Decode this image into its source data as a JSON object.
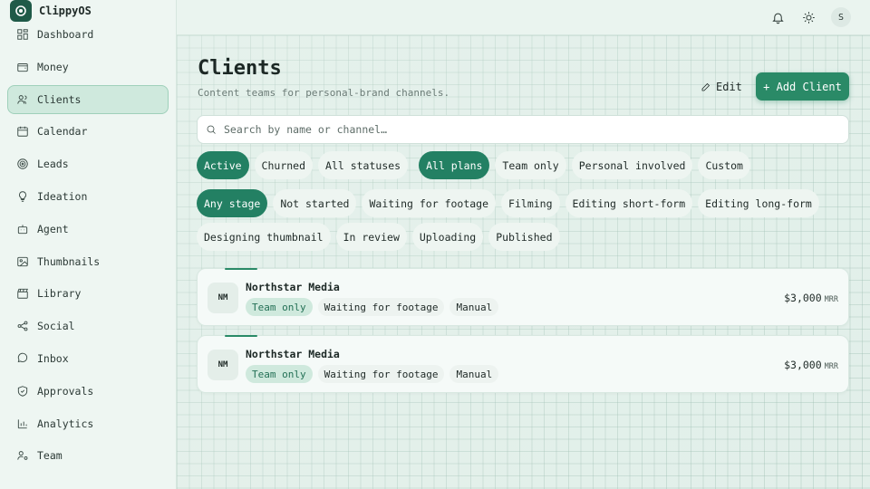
{
  "app": {
    "name": "ClippyOS"
  },
  "sidebar": {
    "items": [
      {
        "label": "Dashboard",
        "icon": "dashboard-icon"
      },
      {
        "label": "Money",
        "icon": "wallet-icon"
      },
      {
        "label": "Clients",
        "icon": "users-icon",
        "active": true
      },
      {
        "label": "Calendar",
        "icon": "calendar-icon"
      },
      {
        "label": "Leads",
        "icon": "target-icon"
      },
      {
        "label": "Ideation",
        "icon": "lightbulb-icon"
      },
      {
        "label": "Agent",
        "icon": "bot-icon"
      },
      {
        "label": "Thumbnails",
        "icon": "image-icon"
      },
      {
        "label": "Library",
        "icon": "clapperboard-icon"
      },
      {
        "label": "Social",
        "icon": "share-icon"
      },
      {
        "label": "Inbox",
        "icon": "message-icon"
      },
      {
        "label": "Approvals",
        "icon": "shield-check-icon"
      },
      {
        "label": "Analytics",
        "icon": "bar-chart-icon"
      },
      {
        "label": "Team",
        "icon": "user-cog-icon"
      }
    ]
  },
  "topbar": {
    "avatar_initial": "S"
  },
  "page": {
    "title": "Clients",
    "subtitle": "Content teams for personal-brand channels.",
    "edit_label": "Edit",
    "add_label": "+ Add Client"
  },
  "search": {
    "placeholder": "Search by name or channel…"
  },
  "filters": {
    "status": [
      {
        "label": "Active",
        "active": true
      },
      {
        "label": "Churned",
        "active": false
      },
      {
        "label": "All statuses",
        "active": false
      }
    ],
    "plan": [
      {
        "label": "All plans",
        "active": true
      },
      {
        "label": "Team only",
        "active": false
      },
      {
        "label": "Personal involved",
        "active": false
      },
      {
        "label": "Custom",
        "active": false
      }
    ],
    "stage_row1": [
      {
        "label": "Any stage",
        "active": true
      },
      {
        "label": "Not started",
        "active": false
      },
      {
        "label": "Waiting for footage",
        "active": false
      },
      {
        "label": "Filming",
        "active": false
      },
      {
        "label": "Editing short-form",
        "active": false
      },
      {
        "label": "Editing long-form",
        "active": false
      }
    ],
    "stage_row2": [
      {
        "label": "Designing thumbnail",
        "active": false
      },
      {
        "label": "In review",
        "active": false
      },
      {
        "label": "Uploading",
        "active": false
      },
      {
        "label": "Published",
        "active": false
      }
    ]
  },
  "clients": [
    {
      "initials": "NM",
      "name": "Northstar Media",
      "plan": "Team only",
      "stage": "Waiting for footage",
      "source": "Manual",
      "mrr": "$3,000",
      "mrr_unit": "MRR"
    },
    {
      "initials": "NM",
      "name": "Northstar Media",
      "plan": "Team only",
      "stage": "Waiting for footage",
      "source": "Manual",
      "mrr": "$3,000",
      "mrr_unit": "MRR"
    }
  ],
  "colors": {
    "accent": "#2a8a67",
    "active_chip": "#238063"
  }
}
